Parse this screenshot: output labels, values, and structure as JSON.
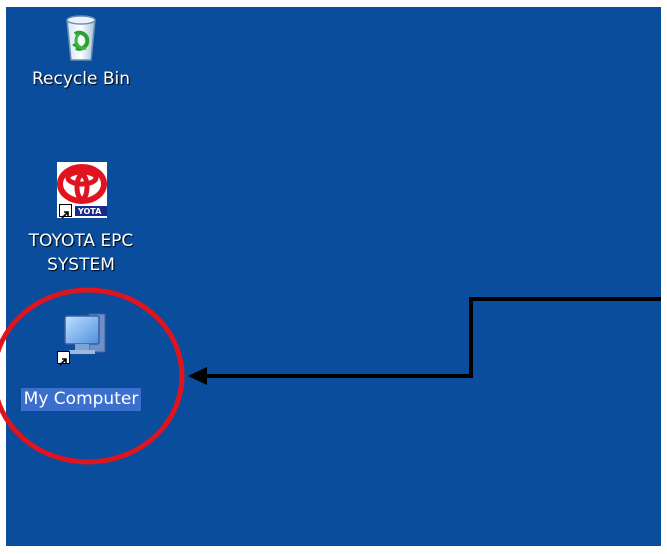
{
  "desktop": {
    "background": "#0a4d9c",
    "icons": [
      {
        "label": "Recycle Bin",
        "icon": "recycle-bin-icon",
        "shortcut": false,
        "selected": false
      },
      {
        "label_lines": [
          "TOYOTA EPC",
          "SYSTEM"
        ],
        "icon": "toyota-logo-icon",
        "shortcut": true,
        "selected": false
      },
      {
        "label": "My Computer",
        "icon": "my-computer-icon",
        "shortcut": true,
        "selected": true
      }
    ]
  },
  "annotation": {
    "circle_color": "#e0141e",
    "arrow_color": "#000000",
    "target": "My Computer"
  }
}
